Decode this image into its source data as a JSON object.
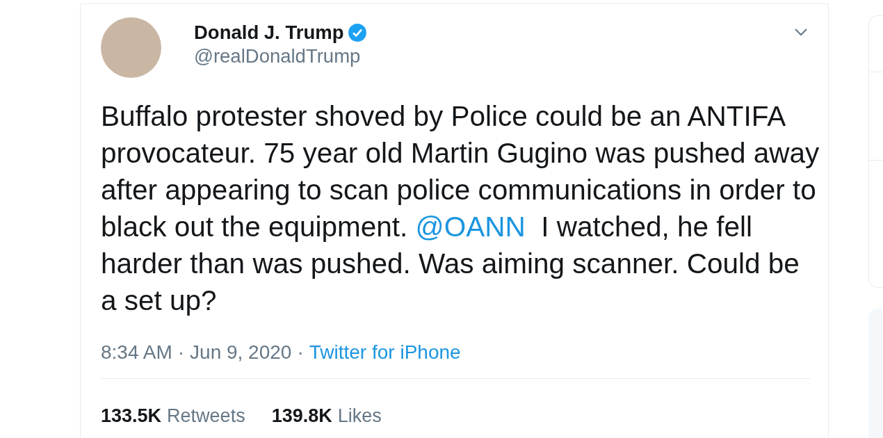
{
  "tweet": {
    "author": {
      "name": "Donald J. Trump",
      "verified": true,
      "handle": "@realDonaldTrump"
    },
    "text": [
      {
        "kind": "text",
        "text": "Buffalo protester shoved by Police could be an ANTIFA provocateur. 75 year old Martin Gugino was pushed away after appearing to scan police communications in order to black out the equipment. "
      },
      {
        "kind": "mention",
        "text": "@OANN"
      },
      {
        "kind": "text",
        "text": "  I watched, he fell harder than was pushed. Was aiming scanner. Could be a set up?"
      }
    ],
    "meta": [
      {
        "kind": "time",
        "text": "8:34 AM"
      },
      {
        "kind": "separator",
        "text": "·"
      },
      {
        "kind": "date",
        "text": "Jun 9, 2020"
      },
      {
        "kind": "separator",
        "text": "·"
      },
      {
        "kind": "source",
        "text": "Twitter for iPhone"
      }
    ],
    "stats": [
      {
        "count": "133.5K",
        "label": "Retweets"
      },
      {
        "count": "139.8K",
        "label": "Likes"
      }
    ]
  }
}
